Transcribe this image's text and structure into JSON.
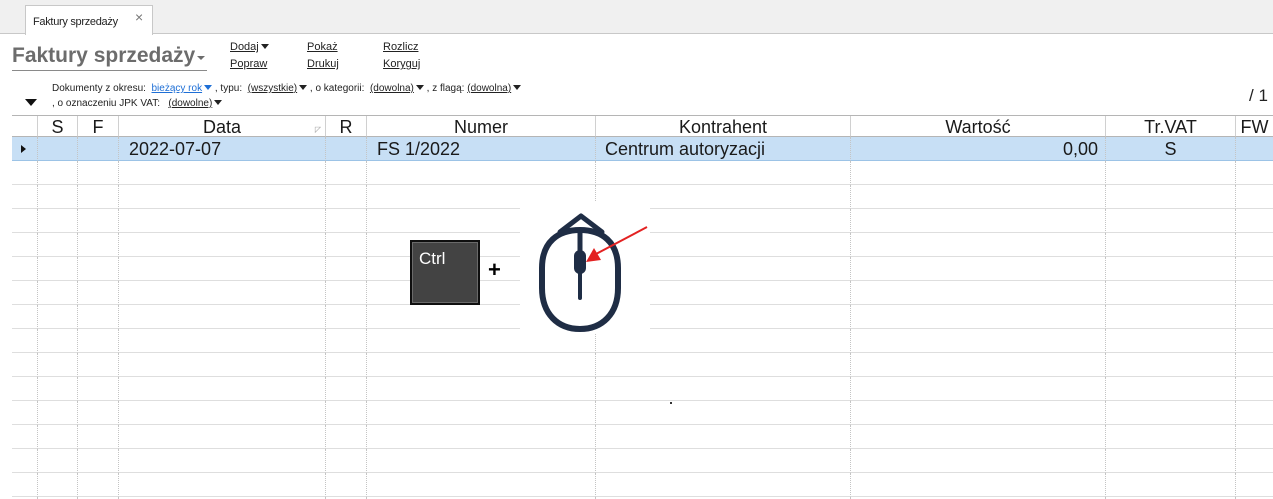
{
  "tab": {
    "label": "Faktury sprzedaży",
    "close_glyph": "×"
  },
  "header": {
    "title": "Faktury sprzedaży",
    "actions": {
      "dodaj": "Dodaj",
      "popraw": "Popraw",
      "pokaz": "Pokaż",
      "drukuj": "Drukuj",
      "rozlicz": "Rozlicz",
      "koryguj": "Koryguj"
    }
  },
  "filters": {
    "period_label": "Dokumenty z okresu:",
    "period_value": "bieżący rok",
    "type_label": ", typu:",
    "type_value": "(wszystkie)",
    "category_label": ", o kategorii:",
    "category_value": "(dowolna)",
    "flag_label": ", z flagą:",
    "flag_value": "(dowolna)",
    "jpk_label": ", o oznaczeniu JPK VAT:",
    "jpk_value": "(dowolne)"
  },
  "page_count": "/ 1",
  "grid": {
    "headers": {
      "s": "S",
      "f": "F",
      "data": "Data",
      "r": "R",
      "numer": "Numer",
      "kontrahent": "Kontrahent",
      "wartosc": "Wartość",
      "trvat": "Tr.VAT",
      "fw": "FW"
    },
    "rows": [
      {
        "s": "",
        "f": "",
        "data": "2022-07-07",
        "r": "",
        "numer": "FS 1/2022",
        "kontrahent": "Centrum autoryzacji",
        "wartosc": "0,00",
        "trvat": "S",
        "fw": ""
      }
    ]
  },
  "overlay": {
    "ctrl_label": "Ctrl",
    "plus": "+",
    "icons": [
      "keyboard-key-icon",
      "mouse-icon",
      "scroll-up-icon",
      "red-arrow-icon"
    ],
    "colors": {
      "mouse_stroke": "#1f2d45",
      "arrow": "#e32222",
      "key_bg": "#434343"
    }
  },
  "colors": {
    "selected_row": "#c7dff5",
    "link_blue": "#1e6fd6",
    "title_gray": "#6c6c6c"
  }
}
